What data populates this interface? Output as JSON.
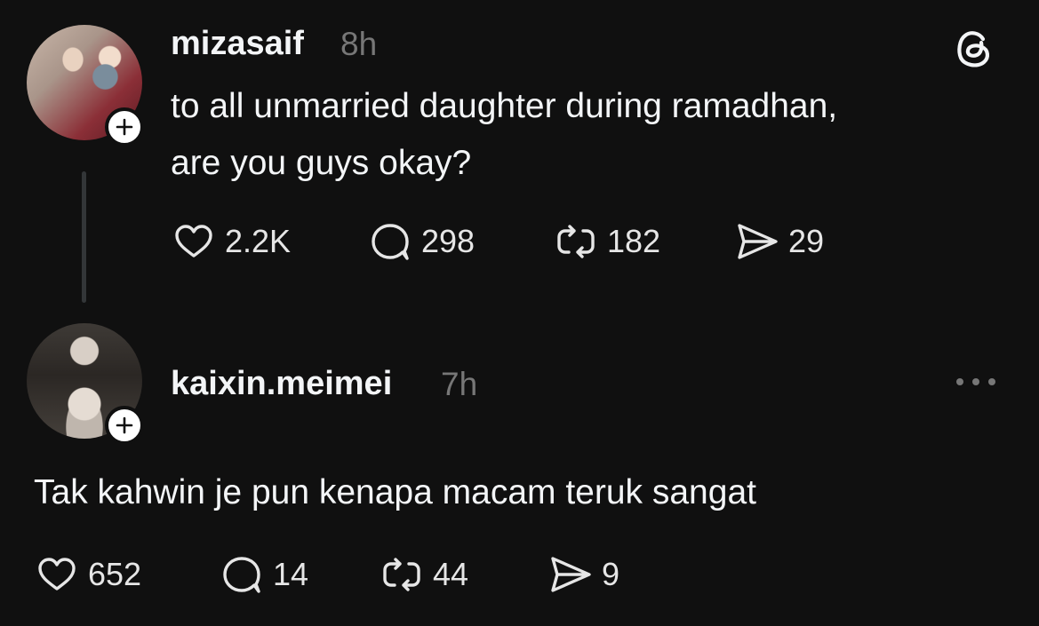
{
  "post": {
    "username": "mizasaif",
    "timestamp": "8h",
    "text_line1": "to all unmarried daughter during ramadhan,",
    "text_line2": "are you guys okay?",
    "likes": "2.2K",
    "replies": "298",
    "reposts": "182",
    "shares": "29"
  },
  "reply": {
    "username": "kaixin.meimei",
    "timestamp": "7h",
    "text": "Tak kahwin je pun kenapa macam teruk sangat",
    "likes": "652",
    "replies": "14",
    "reposts": "44",
    "shares": "9"
  },
  "icons": {
    "brand": "threads-logo-icon",
    "like": "heart-icon",
    "reply": "comment-icon",
    "repost": "repost-icon",
    "share": "send-icon",
    "more": "more-icon",
    "follow": "plus-icon"
  },
  "colors": {
    "background": "#101010",
    "text_primary": "#f3f5f7",
    "text_secondary": "#777777"
  }
}
